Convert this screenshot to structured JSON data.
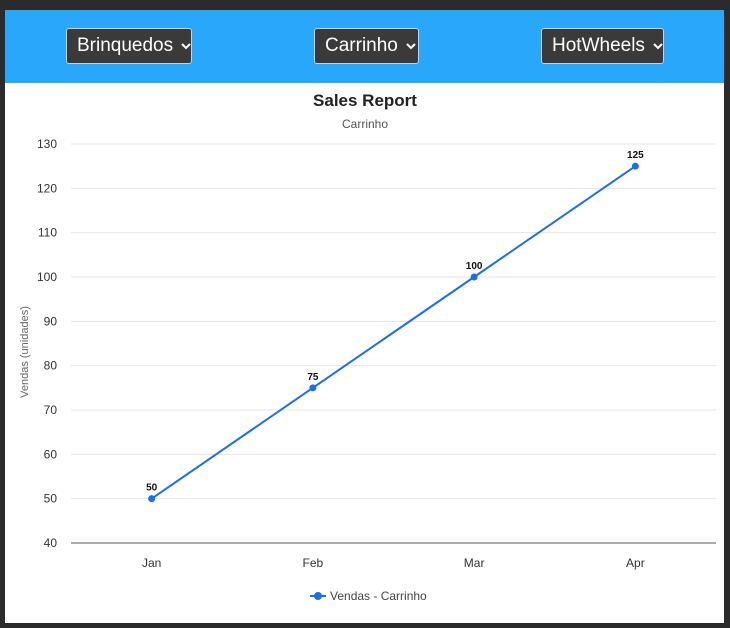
{
  "filters": {
    "category": "Brinquedos",
    "product": "Carrinho",
    "brand": "HotWheels"
  },
  "colors": {
    "header_bg": "#29a7fb",
    "select_bg": "#3a3a3a",
    "series": "#1a6ff0"
  },
  "chart_data": {
    "type": "line",
    "title": "Sales Report",
    "subtitle": "Carrinho",
    "xlabel": "",
    "ylabel": "Vendas (unidades)",
    "categories": [
      "Jan",
      "Feb",
      "Mar",
      "Apr"
    ],
    "series": [
      {
        "name": "Vendas - Carrinho",
        "values": [
          50,
          75,
          100,
          125
        ]
      }
    ],
    "ylim": [
      40,
      130
    ],
    "yticks": [
      40,
      50,
      60,
      70,
      80,
      90,
      100,
      110,
      120,
      130
    ],
    "grid": true,
    "legend": "bottom"
  }
}
